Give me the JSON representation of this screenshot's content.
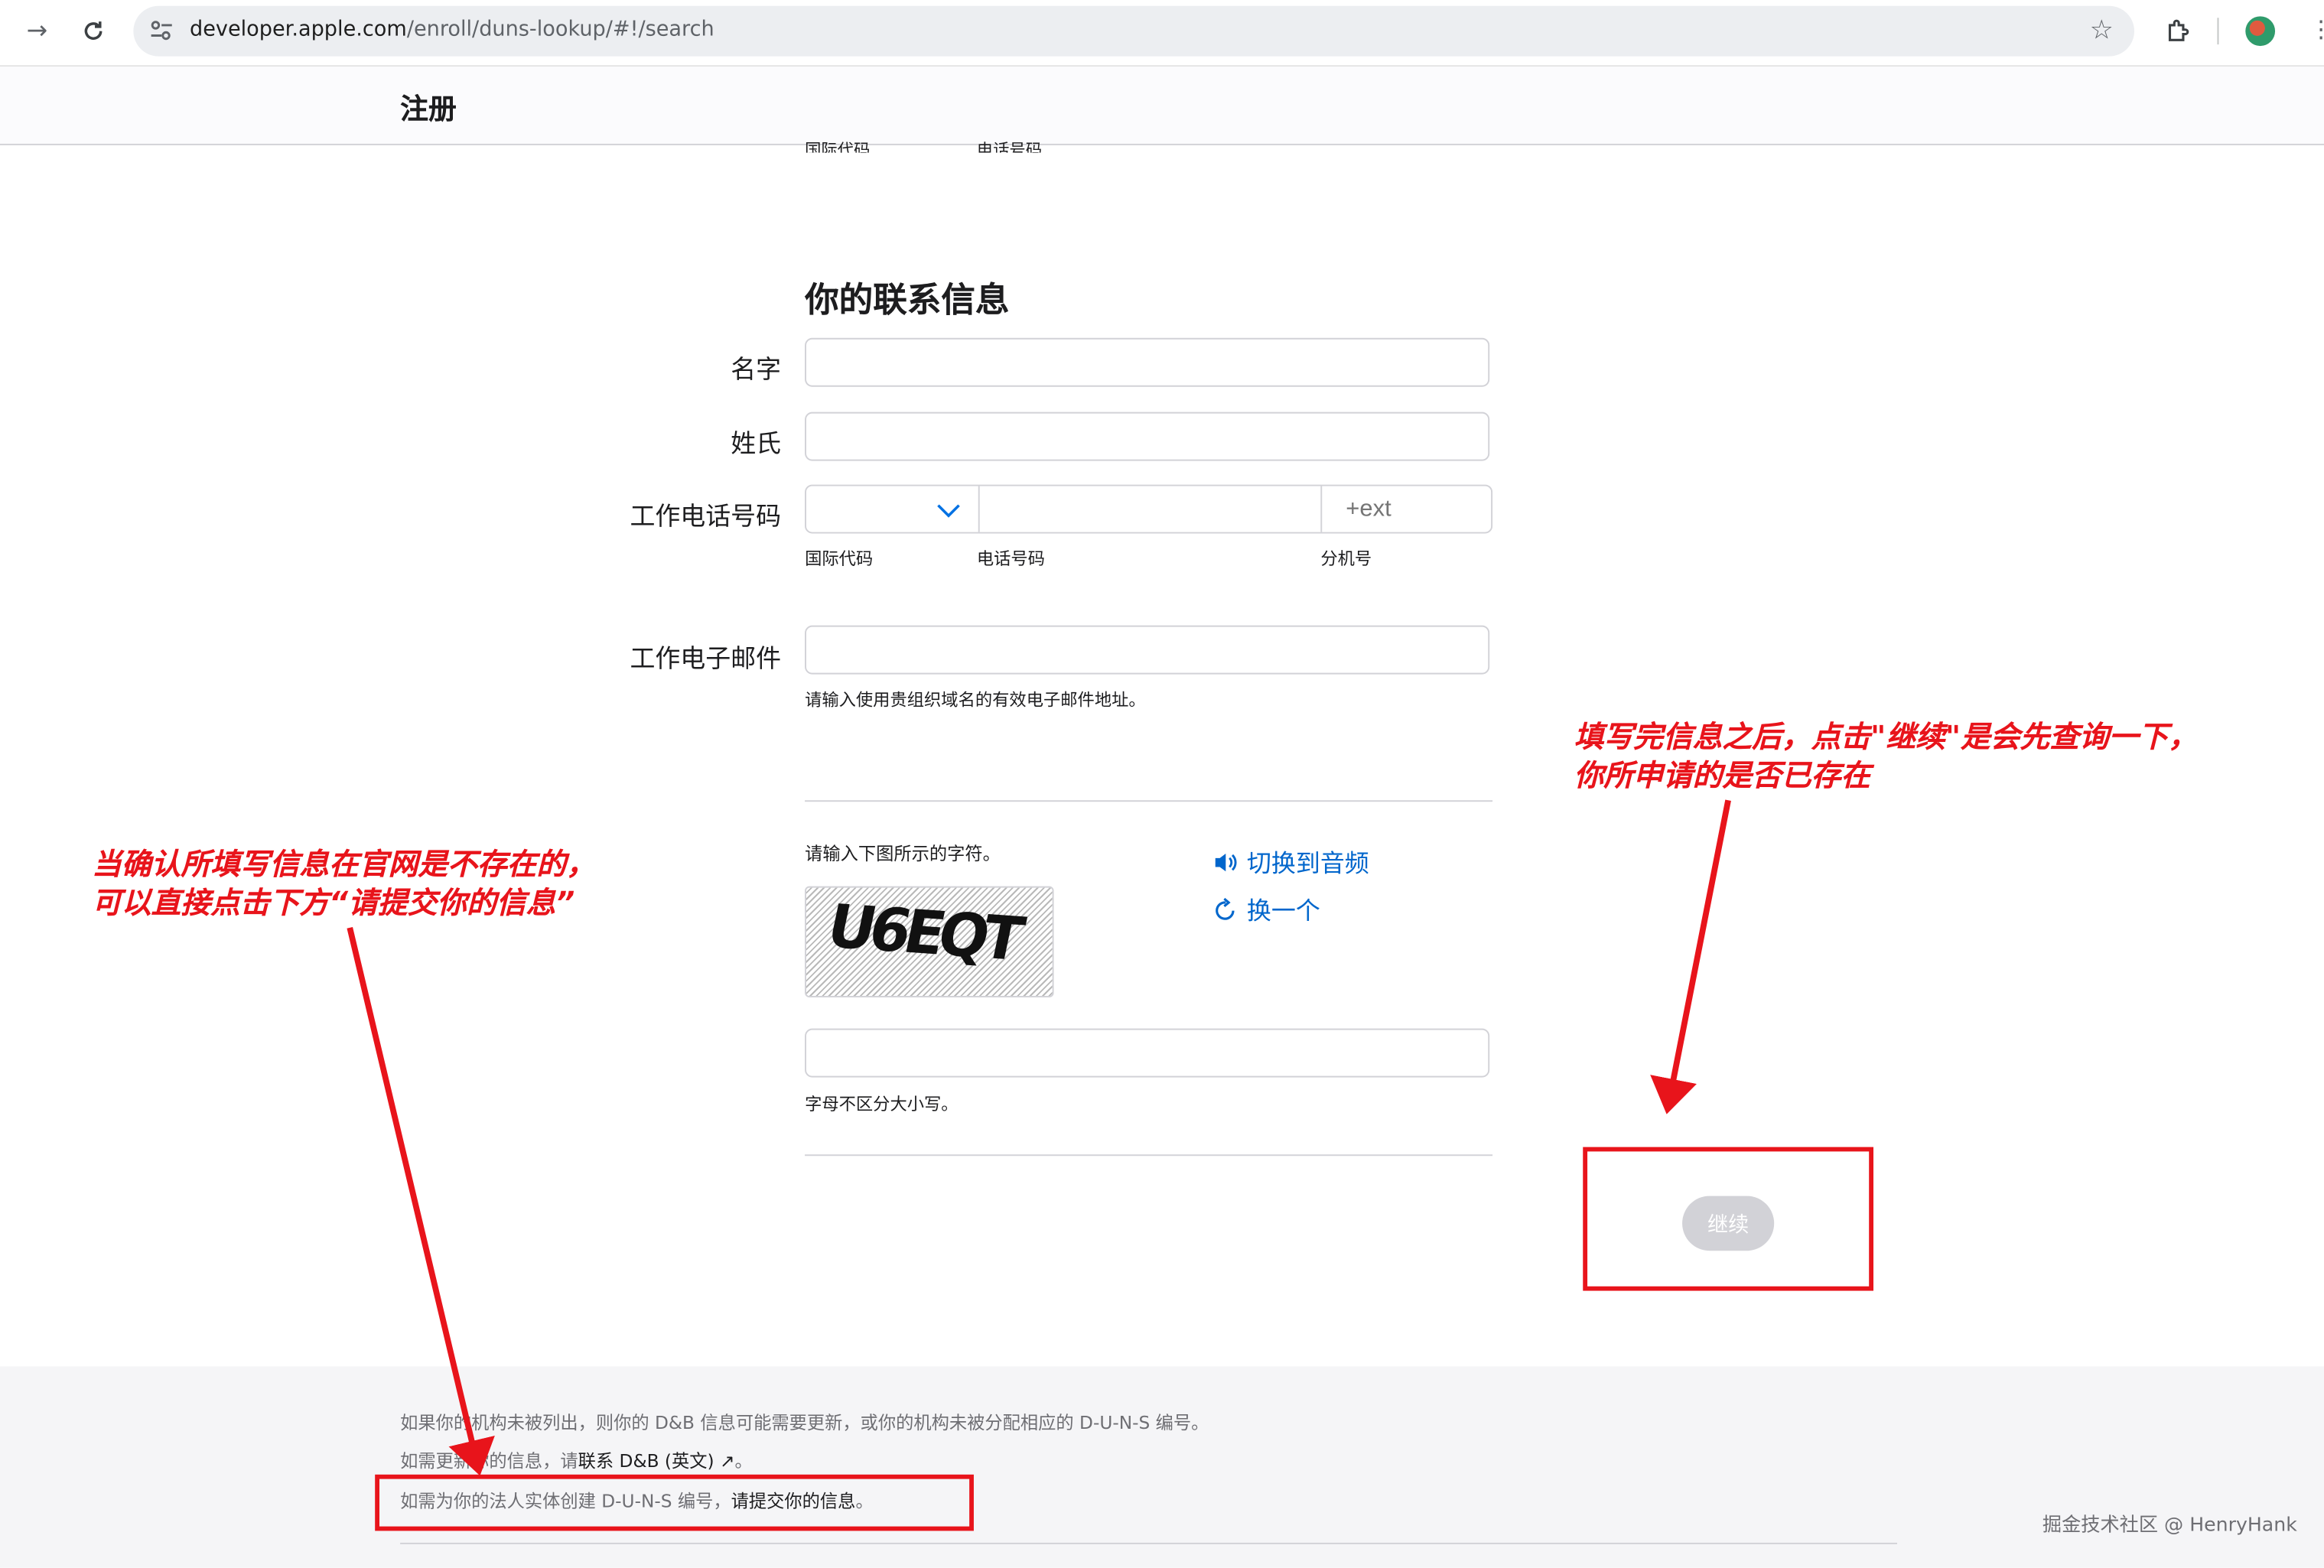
{
  "browser": {
    "url_domain": "developer.apple.com",
    "url_path": "/enroll/duns-lookup/#!/search"
  },
  "header": {
    "title": "注册",
    "scrolled_labels": [
      "国际代码",
      "电话号码"
    ]
  },
  "form": {
    "section_title": "你的联系信息",
    "first_name_label": "名字",
    "first_name_value": "",
    "last_name_label": "姓氏",
    "last_name_value": "",
    "work_phone_label": "工作电话号码",
    "country_code_value": "",
    "phone_value": "",
    "ext_placeholder": "+ext",
    "country_code_sublabel": "国际代码",
    "phone_sublabel": "电话号码",
    "ext_sublabel": "分机号",
    "email_label": "工作电子邮件",
    "email_value": "",
    "email_hint": "请输入使用贵组织域名的有效电子邮件地址。",
    "captcha_prompt": "请输入下图所示的字符。",
    "captcha_text": "U6EQT",
    "audio_link": "切换到音频",
    "refresh_link": "换一个",
    "captcha_value": "",
    "captcha_hint": "字母不区分大小写。",
    "continue_label": "继续"
  },
  "footer": {
    "line1": "如果你的机构未被列出，则你的 D&B 信息可能需要更新，或你的机构未被分配相应的 D-U-N-S 编号。",
    "line2_prefix": "如需更新你的信息，请",
    "line2_link": "联系 D&B (英文) ↗",
    "line2_suffix": "。",
    "line3_prefix": "如需为你的法人实体创建 D-U-N-S 编号，",
    "line3_link": "请提交你的信息",
    "line3_suffix": "。",
    "watermark": "掘金技术社区 @ HenryHank"
  },
  "annotations": {
    "left_note_line1": "当确认所填写信息在官网是不存在的，",
    "left_note_line2": "可以直接点击下方“请提交你的信息”",
    "right_note_line1": "填写完信息之后，点击\"继续\"是会先查询一下，",
    "right_note_line2": "你所申请的是否已存在"
  },
  "colors": {
    "link": "#0066cc",
    "annotation": "#e8141b",
    "button_disabled": "#d2d2d7"
  }
}
